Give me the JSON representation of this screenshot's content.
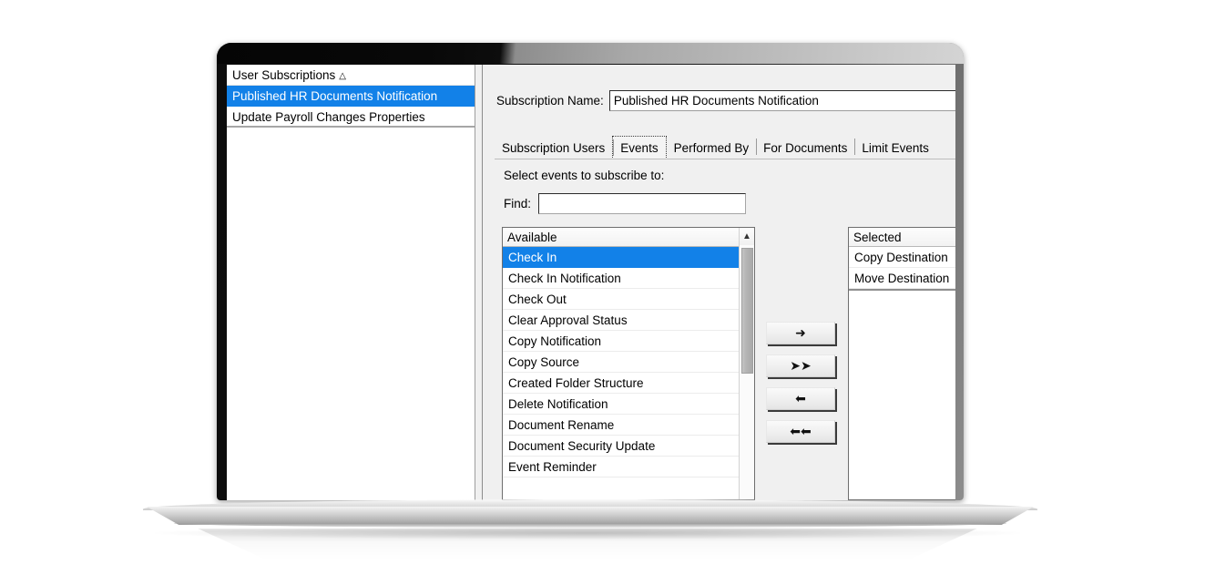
{
  "window": {
    "device": "laptop-mockup"
  },
  "sidebar": {
    "items": [
      {
        "label": "User Subscriptions",
        "caret": "△",
        "selected": false
      },
      {
        "label": "Published HR Documents Notification",
        "caret": "",
        "selected": true
      },
      {
        "label": "Update Payroll Changes Properties",
        "caret": "",
        "selected": false
      }
    ]
  },
  "detail": {
    "name_label": "Subscription Name:",
    "name_value": "Published HR Documents Notification",
    "tabs": [
      {
        "label": "Subscription Users",
        "active": false
      },
      {
        "label": "Events",
        "active": true
      },
      {
        "label": "Performed By",
        "active": false
      },
      {
        "label": "For Documents",
        "active": false
      },
      {
        "label": "Limit Events",
        "active": false
      }
    ],
    "events_tab": {
      "hint": "Select events to subscribe to:",
      "find_label": "Find:",
      "find_value": "",
      "find_placeholder": "",
      "available": {
        "header": "Available",
        "items": [
          {
            "label": "Check In",
            "selected": true
          },
          {
            "label": "Check In Notification",
            "selected": false
          },
          {
            "label": "Check Out",
            "selected": false
          },
          {
            "label": "Clear Approval Status",
            "selected": false
          },
          {
            "label": "Copy Notification",
            "selected": false
          },
          {
            "label": "Copy Source",
            "selected": false
          },
          {
            "label": "Created Folder Structure",
            "selected": false
          },
          {
            "label": "Delete Notification",
            "selected": false
          },
          {
            "label": "Document Rename",
            "selected": false
          },
          {
            "label": "Document Security Update",
            "selected": false
          },
          {
            "label": "Event Reminder",
            "selected": false
          }
        ]
      },
      "selected_list": {
        "header": "Selected",
        "items": [
          {
            "label": "Copy Destination",
            "selected": false
          },
          {
            "label": "Move Destination",
            "selected": false
          }
        ]
      },
      "transfer_buttons": [
        {
          "name": "add-button",
          "glyph": "➜"
        },
        {
          "name": "add-all-button",
          "glyph": "➤➤"
        },
        {
          "name": "remove-button",
          "glyph": "⬅"
        },
        {
          "name": "remove-all-button",
          "glyph": "⬅⬅"
        }
      ]
    }
  },
  "colors": {
    "selection_blue": "#1281e8",
    "window_bg": "#f0f0f0",
    "list_bg": "#ffffff"
  }
}
